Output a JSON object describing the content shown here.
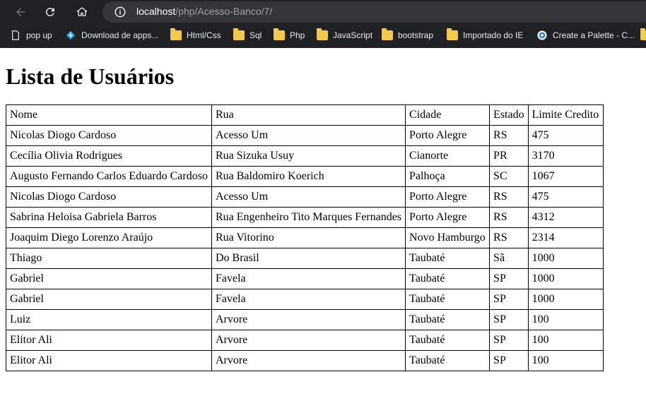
{
  "browser": {
    "url_host": "localhost",
    "url_path": "/php/Acesso-Banco/7/",
    "bookmarks": [
      {
        "label": "pop up",
        "icon": "page-icon"
      },
      {
        "label": "Download de apps...",
        "icon": "download-diamond-icon"
      },
      {
        "label": "Html/Css",
        "icon": "folder-icon"
      },
      {
        "label": "Sql",
        "icon": "folder-icon"
      },
      {
        "label": "Php",
        "icon": "folder-icon"
      },
      {
        "label": "JavaScript",
        "icon": "folder-icon"
      },
      {
        "label": "bootstrap",
        "icon": "folder-icon"
      },
      {
        "label": "Importado do IE",
        "icon": "folder-icon"
      },
      {
        "label": "Create a Palette - C...",
        "icon": "palette-site-icon"
      }
    ]
  },
  "page": {
    "title": "Lista de Usuários",
    "table": {
      "columns": [
        "Nome",
        "Rua",
        "Cidade",
        "Estado",
        "Limite Credito"
      ],
      "rows": [
        [
          "Nicolas Diogo Cardoso",
          "Acesso Um",
          "Porto Alegre",
          "RS",
          "475"
        ],
        [
          "Cecília Olivia Rodrigues",
          "Rua Sizuka Usuy",
          "Cianorte",
          "PR",
          "3170"
        ],
        [
          "Augusto Fernando Carlos Eduardo Cardoso",
          "Rua Baldomiro Koerich",
          "Palhoça",
          "SC",
          "1067"
        ],
        [
          "Nicolas Diogo Cardoso",
          "Acesso Um",
          "Porto Alegre",
          "RS",
          "475"
        ],
        [
          "Sabrina Heloisa Gabriela Barros",
          "Rua Engenheiro Tito Marques Fernandes",
          "Porto Alegre",
          "RS",
          "4312"
        ],
        [
          "Joaquim Diego Lorenzo Araújo",
          "Rua Vitorino",
          "Novo Hamburgo",
          "RS",
          "2314"
        ],
        [
          "Thiago",
          "Do Brasil",
          "Taubaté",
          "Sã",
          "1000"
        ],
        [
          "Gabriel",
          "Favela",
          "Taubaté",
          "SP",
          "1000"
        ],
        [
          "Gabriel",
          "Favela",
          "Taubaté",
          "SP",
          "1000"
        ],
        [
          "Luiz",
          "Arvore",
          "Taubaté",
          "SP",
          "100"
        ],
        [
          "Elitor Ali",
          "Arvore",
          "Taubaté",
          "SP",
          "100"
        ],
        [
          "Elitor Ali",
          "Arvore",
          "Taubaté",
          "SP",
          "100"
        ]
      ]
    }
  }
}
